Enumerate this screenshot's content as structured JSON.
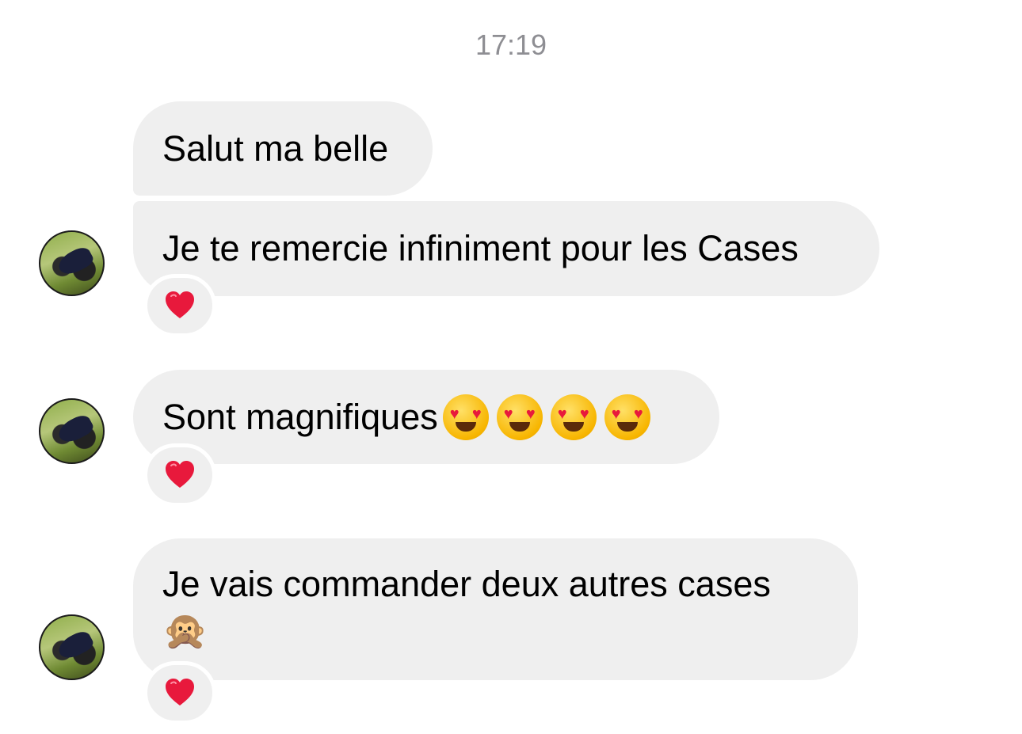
{
  "thread": {
    "timestamp": "17:19",
    "messages": [
      {
        "text": "Salut ma belle",
        "reaction": "heart"
      },
      {
        "text": "Je te remercie infiniment pour les Cases",
        "reaction": "heart"
      },
      {
        "text": "Sont magnifiques",
        "emoji": [
          "heart-eyes",
          "heart-eyes",
          "heart-eyes",
          "heart-eyes"
        ],
        "reaction": "heart"
      },
      {
        "text": "Je vais commander deux autres cases",
        "emoji": [
          "speak-no-evil-monkey"
        ],
        "reaction": "heart"
      }
    ]
  },
  "colors": {
    "bubble": "#efefef",
    "timestamp": "#8e8e93",
    "heart": "#e8193c"
  }
}
